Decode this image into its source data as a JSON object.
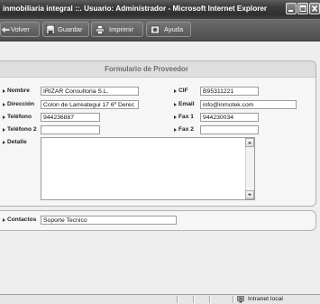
{
  "window": {
    "title": "inmobiliaria integral ::. Usuario: Administrador - Microsoft Internet Explorer",
    "control_icons": [
      "minimize-icon",
      "maximize-icon",
      "close-icon"
    ]
  },
  "toolbar": {
    "buttons": [
      {
        "label": "Volver",
        "icon": "back-arrow-icon"
      },
      {
        "label": "Guardar",
        "icon": "save-icon"
      },
      {
        "label": "Imprimir",
        "icon": "printer-icon"
      },
      {
        "label": "Ayuda",
        "icon": "help-icon"
      }
    ]
  },
  "form": {
    "title": "Formulario de Proveedor",
    "bullet_icon": "bullet-arrow-icon",
    "nombre": {
      "label": "Nombre",
      "value": "IRIZAR Consultoria S.L."
    },
    "cif": {
      "label": "CIF",
      "value": "B95311221"
    },
    "direccion": {
      "label": "Dirección",
      "value": "Colon de Larreategui 17 6º Derec"
    },
    "email": {
      "label": "Email",
      "value": "info@inmotek.com"
    },
    "telefono": {
      "label": "Teléfono",
      "value": "944236887"
    },
    "fax1": {
      "label": "Fax 1",
      "value": "944230034"
    },
    "telefono2": {
      "label": "Teléfono 2",
      "value": ""
    },
    "fax2": {
      "label": "Fax 2",
      "value": ""
    },
    "detalle": {
      "label": "Detalle",
      "value": ""
    }
  },
  "contactos": {
    "label": "Contactos",
    "value": "Soporte Tecnico"
  },
  "status_bar": {
    "zone": "Intranet local",
    "zone_icon": "intranet-zone-icon"
  },
  "colors": {
    "title_bar": "#353535",
    "toolbar": "#565656",
    "page_background": "#eeeeee",
    "panel_background": "#f6f6f6",
    "panel_header": "#dedede",
    "panel_border": "#b3b3b3",
    "status_bar": "#e6e6e6",
    "label_text": "#1e1e1e",
    "header_text": "#6d6d6d"
  }
}
